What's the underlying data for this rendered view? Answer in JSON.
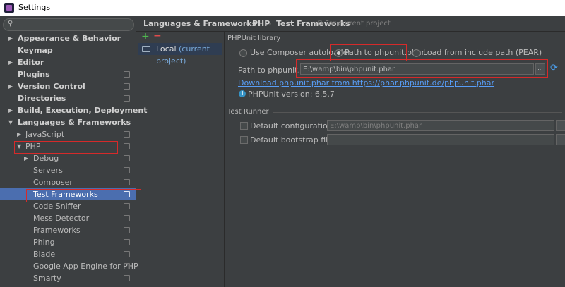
{
  "window": {
    "title": "Settings"
  },
  "sidebar": {
    "search_placeholder": "",
    "items": [
      {
        "label": "Appearance & Behavior",
        "arrow": "▶"
      },
      {
        "label": "Keymap",
        "arrow": ""
      },
      {
        "label": "Editor",
        "arrow": "▶"
      },
      {
        "label": "Plugins",
        "arrow": ""
      },
      {
        "label": "Version Control",
        "arrow": "▶"
      },
      {
        "label": "Directories",
        "arrow": ""
      },
      {
        "label": "Build, Execution, Deployment",
        "arrow": "▶"
      },
      {
        "label": "Languages & Frameworks",
        "arrow": "▼"
      },
      {
        "label": "JavaScript",
        "arrow": "▶"
      },
      {
        "label": "PHP",
        "arrow": "▼"
      },
      {
        "label": "Debug",
        "arrow": "▶"
      },
      {
        "label": "Servers",
        "arrow": ""
      },
      {
        "label": "Composer",
        "arrow": ""
      },
      {
        "label": "Test Frameworks",
        "arrow": ""
      },
      {
        "label": "Code Sniffer",
        "arrow": ""
      },
      {
        "label": "Mess Detector",
        "arrow": ""
      },
      {
        "label": "Frameworks",
        "arrow": ""
      },
      {
        "label": "Phing",
        "arrow": ""
      },
      {
        "label": "Blade",
        "arrow": ""
      },
      {
        "label": "Google App Engine for PHP",
        "arrow": ""
      },
      {
        "label": "Smarty",
        "arrow": ""
      }
    ]
  },
  "breadcrumb": {
    "part1": "Languages & Frameworks",
    "part2": "PHP",
    "part3": "Test Frameworks",
    "sep": "›",
    "for_project": "For current project"
  },
  "interpreters": {
    "add": "+",
    "remove": "−",
    "item_name": "Local",
    "item_suffix": "(current project)"
  },
  "phpunit": {
    "section_title": "PHPUnit library",
    "radio_composer": "Use Composer autoloader",
    "radio_phar": "Path to phpunit.phar",
    "radio_include": "Load from include path (PEAR)",
    "path_label": "Path to phpunit.phar:",
    "path_value": "E:\\wamp\\bin\\phpunit.phar",
    "browse": "...",
    "download_link": "Download phpunit.phar from https://phar.phpunit.de/phpunit.phar",
    "version_text": "PHPUnit version: 6.5.7"
  },
  "test_runner": {
    "section_title": "Test Runner",
    "default_config_label": "Default configuration file:",
    "default_config_value": "E:\\wamp\\bin\\phpunit.phar",
    "default_bootstrap_label": "Default bootstrap file:",
    "default_bootstrap_value": "",
    "browse": "..."
  },
  "colors": {
    "background": "#3c3f41",
    "selection": "#4b6eaf",
    "link": "#589df6",
    "highlight_red": "#d62a2a"
  }
}
